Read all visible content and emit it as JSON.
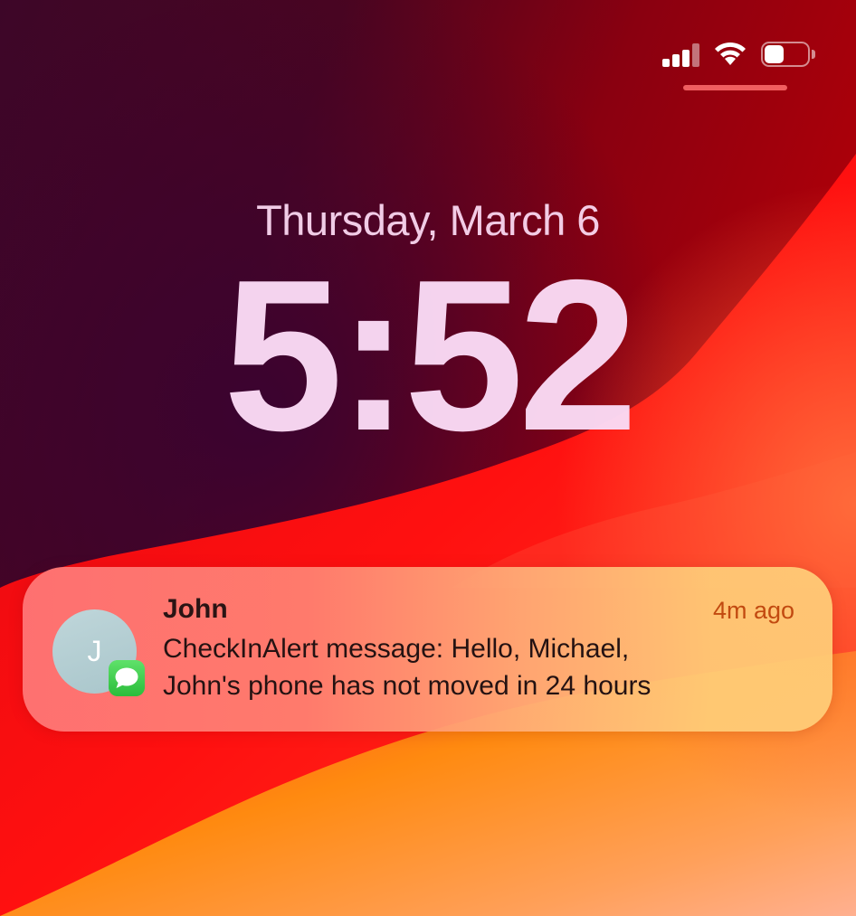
{
  "status_bar": {
    "signal_bars_active": 3,
    "signal_bars_total": 4,
    "wifi_icon": "wifi-icon",
    "battery_level": 0.45,
    "icon_color": "#ffffff"
  },
  "lock_screen": {
    "date": "Thursday, March 6",
    "time": "5:52",
    "text_color": "#fadaf5"
  },
  "notification": {
    "avatar_initial": "J",
    "app_icon": "messages-icon",
    "sender": "John",
    "timestamp": "4m ago",
    "message_lines": [
      "CheckInAlert message: Hello, Michael,",
      "John's phone has not moved in 24 hours"
    ],
    "timestamp_color": "#c24a10",
    "badge_color": "#34c759"
  },
  "wallpaper": {
    "dark_color": "#3a0426",
    "red_color": "#ff1a1a",
    "orange_color": "#ff8a10"
  }
}
